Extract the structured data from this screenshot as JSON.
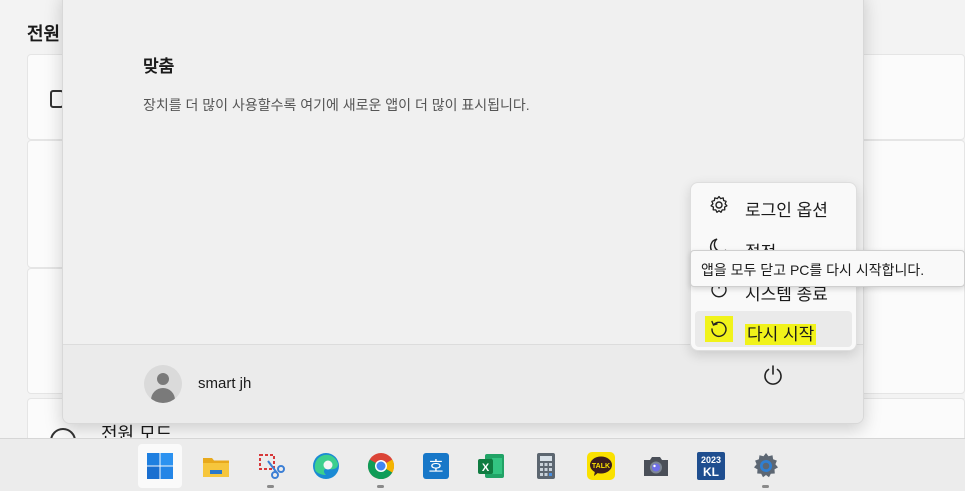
{
  "background": {
    "section_title": "전원",
    "power_mode_label": "전원 모드"
  },
  "start_menu": {
    "recommended": {
      "heading": "맞춤",
      "empty_text": "장치를 더 많이 사용할수록 여기에 새로운 앱이 더 많이 표시됩니다."
    },
    "user": {
      "name": "smart jh"
    }
  },
  "power_menu": {
    "items": [
      {
        "label": "로그인 옵션",
        "icon": "gear-icon"
      },
      {
        "label": "절전",
        "icon": "moon-icon"
      },
      {
        "label": "시스템 종료",
        "icon": "power-icon"
      },
      {
        "label": "다시 시작",
        "icon": "restart-icon"
      }
    ],
    "highlight_color": "#f1f31a",
    "tooltip": "앱을 모두 닫고 PC를 다시 시작합니다."
  },
  "taskbar": {
    "apps": [
      {
        "name": "start",
        "icon": "windows-start-icon"
      },
      {
        "name": "file-explorer",
        "icon": "folder-icon"
      },
      {
        "name": "snipping-tool",
        "icon": "scissors-icon"
      },
      {
        "name": "edge",
        "icon": "edge-icon"
      },
      {
        "name": "chrome",
        "icon": "chrome-icon"
      },
      {
        "name": "hangul",
        "icon": "hangul-icon",
        "glyph": "호"
      },
      {
        "name": "excel",
        "icon": "excel-icon",
        "glyph": "X"
      },
      {
        "name": "calculator",
        "icon": "calculator-icon"
      },
      {
        "name": "kakaotalk",
        "icon": "kakaotalk-icon",
        "glyph": "TALK"
      },
      {
        "name": "camera",
        "icon": "camera-icon"
      },
      {
        "name": "kl-2023",
        "icon": "kl-app-icon",
        "glyph_top": "2023",
        "glyph_bottom": "KL"
      },
      {
        "name": "settings",
        "icon": "settings-gear-icon"
      }
    ]
  }
}
